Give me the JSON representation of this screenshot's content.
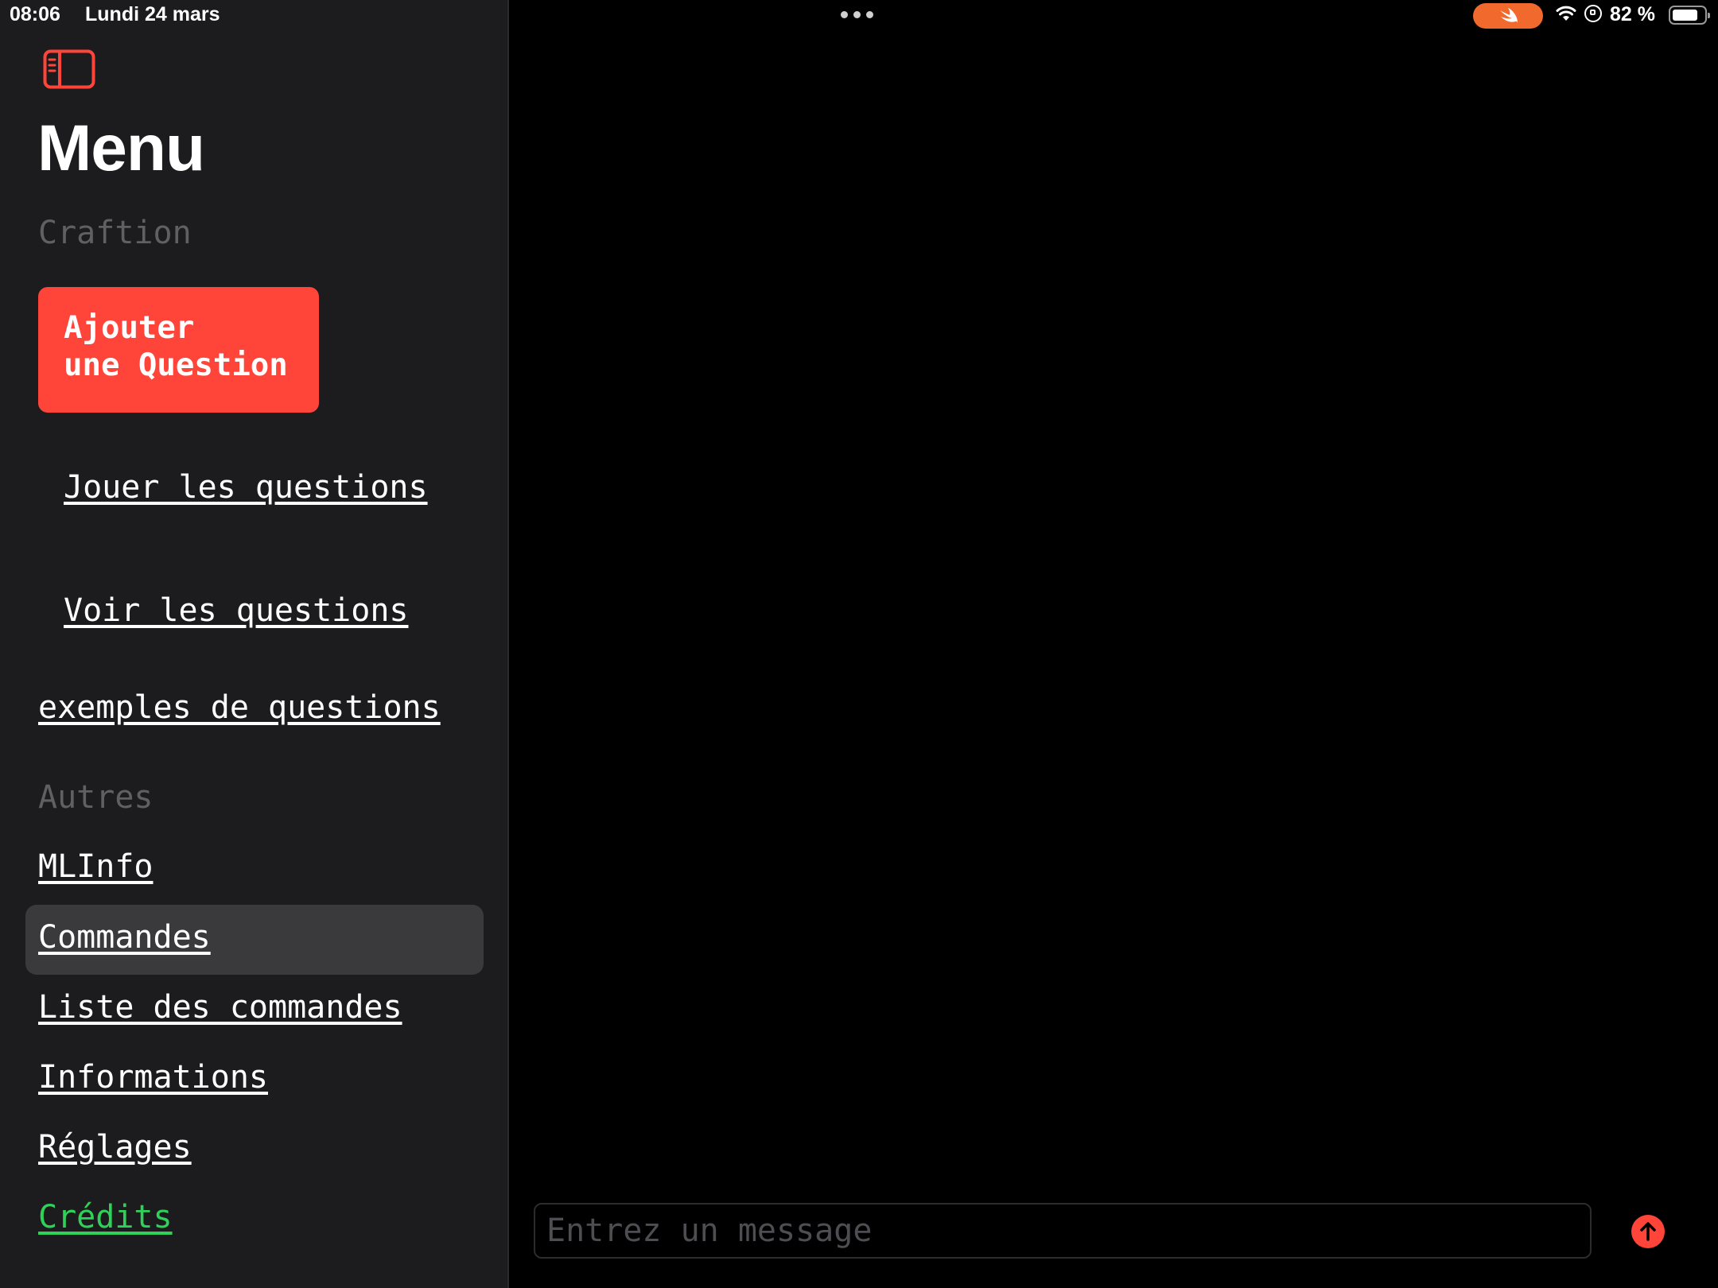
{
  "status_bar": {
    "time": "08:06",
    "date": "Lundi 24 mars",
    "battery_percent": "82 %",
    "battery_level": 0.82,
    "swift_pill_color": "#f2692e"
  },
  "sidebar": {
    "title": "Menu",
    "toggle_icon": "sidebar-toggle-icon",
    "sections": [
      {
        "label": "Craftion"
      },
      {
        "label": "Autres"
      }
    ],
    "add_button": {
      "line1": "Ajouter",
      "line2": "une Question",
      "color": "#ff453a"
    },
    "links": {
      "play": "Jouer les questions",
      "view": "Voir les questions",
      "examples": "exemples de questions",
      "mlinfo": "MLInfo",
      "commands": "Commandes",
      "command_list": "Liste des commandes",
      "info": "Informations",
      "settings": "Réglages",
      "credits": "Crédits"
    },
    "selected_item": "Commandes",
    "credits_color": "#30d158"
  },
  "main": {
    "message_input": {
      "placeholder": "Entrez un message",
      "value": ""
    },
    "send_icon": "arrow-up-circle-icon"
  }
}
